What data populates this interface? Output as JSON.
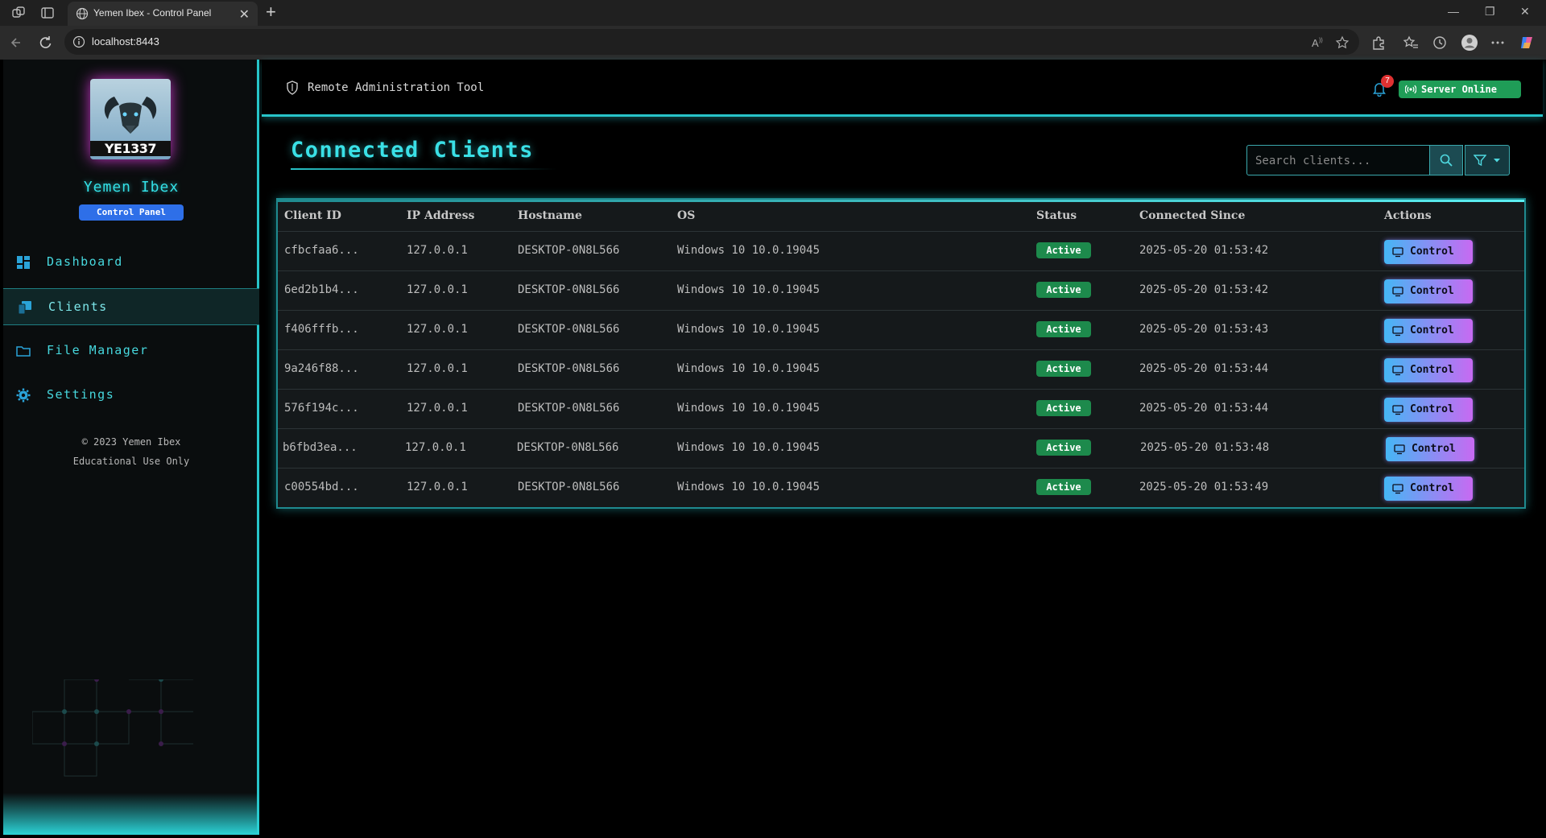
{
  "browser": {
    "tab_title": "Yemen Ibex - Control Panel",
    "address": "localhost:8443"
  },
  "sidebar": {
    "logo_text": "YE1337",
    "brand_name": "Yemen Ibex",
    "brand_badge": "Control Panel",
    "items": [
      {
        "label": "Dashboard",
        "icon": "dashboard-icon",
        "active": false
      },
      {
        "label": "Clients",
        "icon": "clients-icon",
        "active": true
      },
      {
        "label": "File Manager",
        "icon": "folder-icon",
        "active": false
      },
      {
        "label": "Settings",
        "icon": "gear-icon",
        "active": false
      }
    ],
    "footer_line1": "© 2023 Yemen Ibex",
    "footer_line2": "Educational Use Only"
  },
  "topbar": {
    "title": "Remote Administration Tool",
    "notification_count": "7",
    "server_status": "Server Online"
  },
  "page": {
    "title": "Connected Clients",
    "search_placeholder": "Search clients..."
  },
  "table": {
    "headers": [
      "Client ID",
      "IP Address",
      "Hostname",
      "OS",
      "Status",
      "Connected Since",
      "Actions"
    ],
    "rows": [
      {
        "client_id": "cfbcfaa6...",
        "ip": "127.0.0.1",
        "hostname": "DESKTOP-0N8L566",
        "os": "Windows 10 10.0.19045",
        "status": "Active",
        "since": "2025-05-20 01:53:42",
        "action": "Control"
      },
      {
        "client_id": "6ed2b1b4...",
        "ip": "127.0.0.1",
        "hostname": "DESKTOP-0N8L566",
        "os": "Windows 10 10.0.19045",
        "status": "Active",
        "since": "2025-05-20 01:53:42",
        "action": "Control"
      },
      {
        "client_id": "f406fffb...",
        "ip": "127.0.0.1",
        "hostname": "DESKTOP-0N8L566",
        "os": "Windows 10 10.0.19045",
        "status": "Active",
        "since": "2025-05-20 01:53:43",
        "action": "Control"
      },
      {
        "client_id": "9a246f88...",
        "ip": "127.0.0.1",
        "hostname": "DESKTOP-0N8L566",
        "os": "Windows 10 10.0.19045",
        "status": "Active",
        "since": "2025-05-20 01:53:44",
        "action": "Control"
      },
      {
        "client_id": "576f194c...",
        "ip": "127.0.0.1",
        "hostname": "DESKTOP-0N8L566",
        "os": "Windows 10 10.0.19045",
        "status": "Active",
        "since": "2025-05-20 01:53:44",
        "action": "Control"
      },
      {
        "client_id": "b6fbd3ea...",
        "ip": "127.0.0.1",
        "hostname": "DESKTOP-0N8L566",
        "os": "Windows 10 10.0.19045",
        "status": "Active",
        "since": "2025-05-20 01:53:48",
        "action": "Control"
      },
      {
        "client_id": "c00554bd...",
        "ip": "127.0.0.1",
        "hostname": "DESKTOP-0N8L566",
        "os": "Windows 10 10.0.19045",
        "status": "Active",
        "since": "2025-05-20 01:53:49",
        "action": "Control"
      }
    ]
  },
  "colors": {
    "accent": "#27c4c9",
    "status_active": "#1d8a4c",
    "server_online": "#1f9d57",
    "brand_badge": "#2e6fe8"
  }
}
